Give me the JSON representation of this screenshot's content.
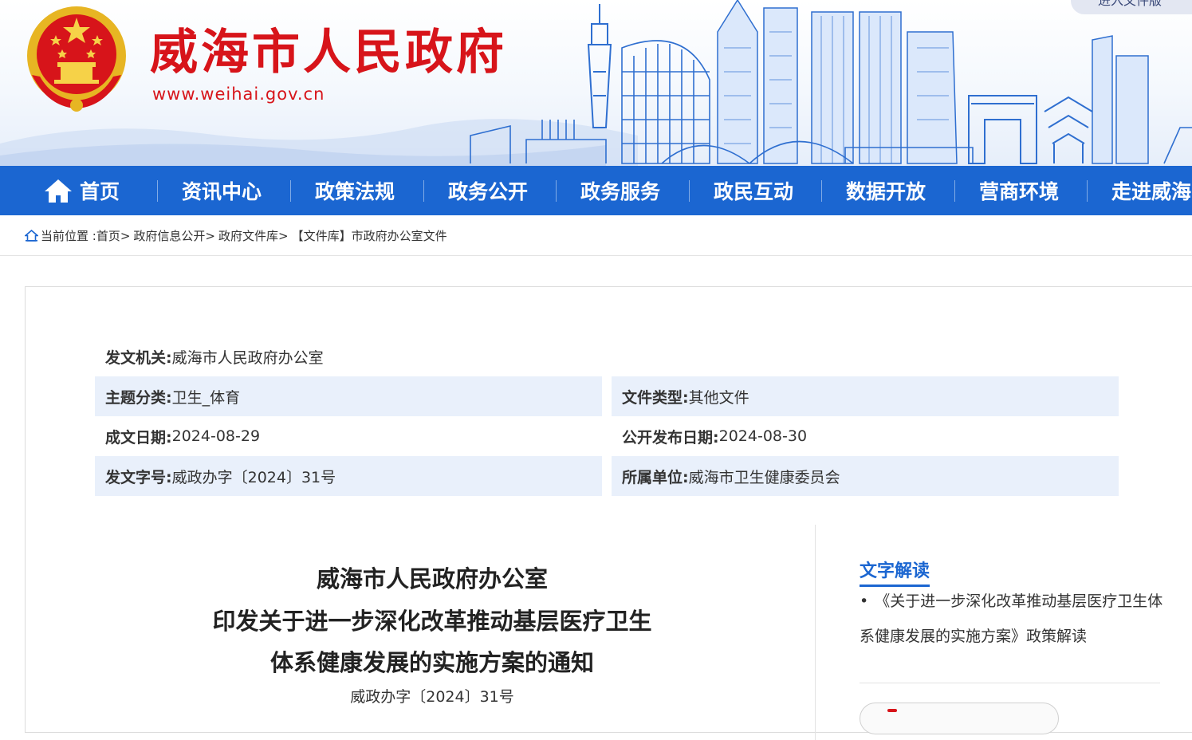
{
  "header": {
    "site_title": "威海市人民政府",
    "site_url": "www.weihai.gov.cn",
    "top_link": "进入文件版"
  },
  "nav": {
    "items": [
      {
        "label": "首页",
        "icon": "home-icon"
      },
      {
        "label": "资讯中心"
      },
      {
        "label": "政策法规"
      },
      {
        "label": "政务公开"
      },
      {
        "label": "政务服务"
      },
      {
        "label": "政民互动"
      },
      {
        "label": "数据开放"
      },
      {
        "label": "营商环境"
      },
      {
        "label": "走进威海"
      }
    ]
  },
  "breadcrumb": {
    "prefix": "当前位置 :",
    "items": [
      "首页>",
      "政府信息公开>",
      "政府文件库>",
      "【文件库】市政府办公室文件"
    ]
  },
  "meta": {
    "issuer_label": "发文机关:",
    "issuer": "威海市人民政府办公室",
    "topic_label": "主题分类:",
    "topic": "卫生_体育",
    "type_label": "文件类型:",
    "type": "其他文件",
    "date_label": "成文日期:",
    "date": "2024-08-29",
    "publish_label": "公开发布日期:",
    "publish": "2024-08-30",
    "number_label": "发文字号:",
    "number": "威政办字〔2024〕31号",
    "unit_label": "所属单位:",
    "unit": "威海市卫生健康委员会"
  },
  "document": {
    "title_line1": "威海市人民政府办公室",
    "title_line2": "印发关于进一步深化改革推动基层医疗卫生",
    "title_line3": "体系健康发展的实施方案的通知",
    "number": "威政办字〔2024〕31号"
  },
  "side": {
    "heading": "文字解读",
    "bullet": "•",
    "link_text": "《关于进一步深化改革推动基层医疗卫生体系健康发展的实施方案》政策解读"
  },
  "colors": {
    "brand_red": "#d7141a",
    "nav_blue": "#1b66d1",
    "row_shade": "#e9f0fb"
  }
}
